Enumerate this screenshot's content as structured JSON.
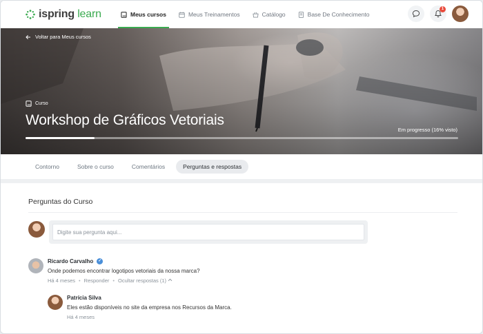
{
  "brand": {
    "logo_main": "ispring",
    "logo_accent": "learn",
    "accent_color": "#3aaa4f"
  },
  "nav": {
    "items": [
      {
        "label": "Meus cursos",
        "icon": "book-icon",
        "active": true
      },
      {
        "label": "Meus Treinamentos",
        "icon": "calendar-icon",
        "active": false
      },
      {
        "label": "Catálogo",
        "icon": "basket-icon",
        "active": false
      },
      {
        "label": "Base De Conhecimento",
        "icon": "document-icon",
        "active": false
      }
    ],
    "notification_count": "1"
  },
  "hero": {
    "back_label": "Voltar para Meus cursos",
    "type_label": "Curso",
    "title": "Workshop de Gráficos Vetoriais",
    "progress_text": "Em progresso (16% visto)",
    "progress_fraction": 0.16
  },
  "tabs": [
    {
      "label": "Contorno",
      "active": false
    },
    {
      "label": "Sobre o curso",
      "active": false
    },
    {
      "label": "Comentários",
      "active": false
    },
    {
      "label": "Perguntas e respostas",
      "active": true
    }
  ],
  "questions": {
    "title": "Perguntas do Curso",
    "input_placeholder": "Digite sua pergunta aqui...",
    "items": [
      {
        "author": "Ricardo Carvalho",
        "verified": true,
        "text": "Onde podemos encontrar logotipos vetoriais da nossa marca?",
        "time": "Há 4 meses",
        "reply_label": "Responder",
        "hide_label": "Ocultar respostas (1)"
      }
    ],
    "replies": [
      {
        "author": "Patrícia Silva",
        "text": "Eles estão disponíveis no site da empresa nos Recursos da Marca.",
        "time": "Há 4 meses"
      }
    ]
  }
}
